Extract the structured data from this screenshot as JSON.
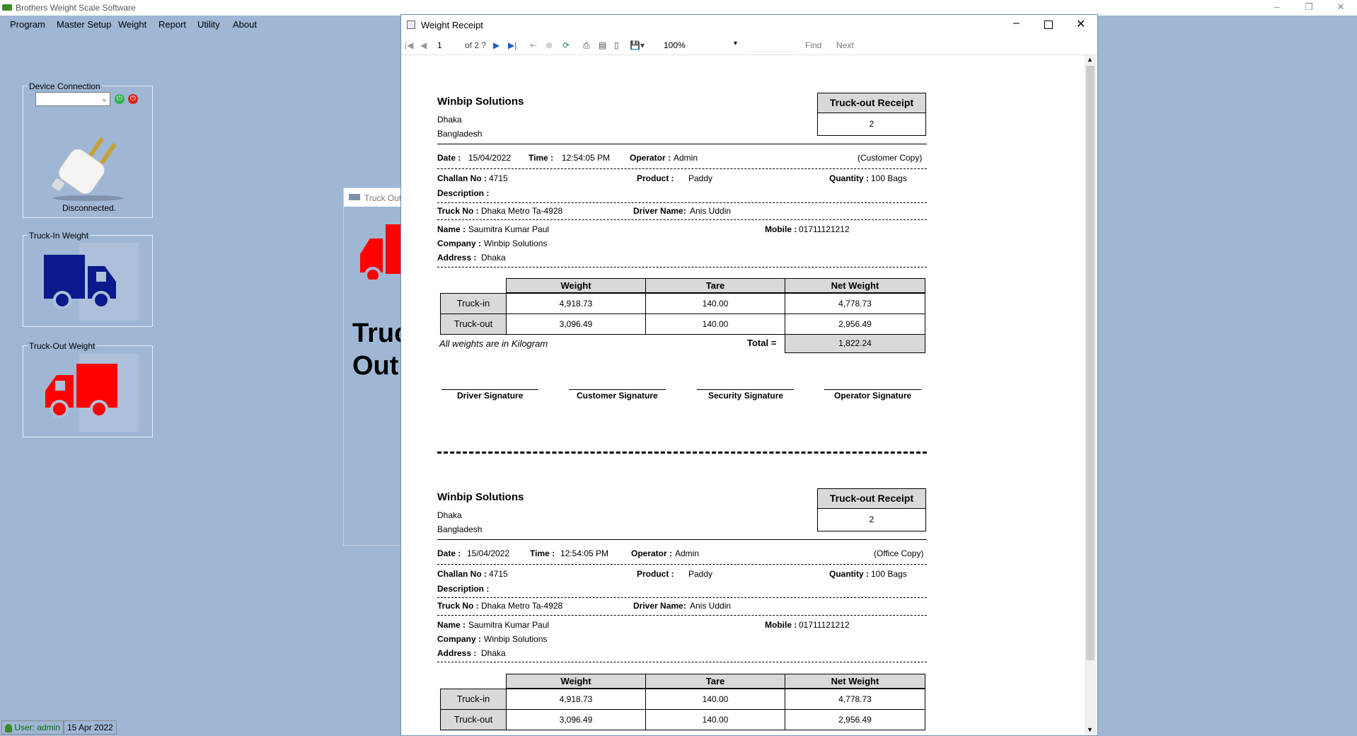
{
  "app": {
    "title": "Brothers Weight Scale Software",
    "menu": [
      "Program",
      "Master Setup",
      "Weight",
      "Report",
      "Utility",
      "About"
    ],
    "window_controls": [
      "–",
      "❐",
      "✕"
    ]
  },
  "device": {
    "group_label": "Device Connection",
    "status": "Disconnected."
  },
  "tiles": {
    "truck_in_label": "Truck-In Weight",
    "truck_out_label": "Truck-Out Weight"
  },
  "bg_form": {
    "title": "Truck Out",
    "big_text_1": "Truc",
    "big_text_2": "Out"
  },
  "status_bar": {
    "user": "User: admin",
    "date": "15 Apr 2022"
  },
  "report_window": {
    "title": "Weight Receipt",
    "page_current": "1",
    "page_of": "of  2 ?",
    "zoom": "100%",
    "find": "Find",
    "next": "Next"
  },
  "receipts": [
    {
      "company": "Winbip Solutions",
      "city": "Dhaka",
      "country": "Bangladesh",
      "receipt_title": "Truck-out Receipt",
      "receipt_no": "2",
      "date_label": "Date :",
      "date": "15/04/2022",
      "time_label": "Time :",
      "time": "12:54:05 PM",
      "operator_label": "Operator :",
      "operator": "Admin",
      "copy": "(Customer Copy)",
      "challan_label": "Challan No :",
      "challan": "4715",
      "product_label": "Product :",
      "product": "Paddy",
      "quantity_label": "Quantity :",
      "quantity": "100 Bags",
      "description_label": "Description :",
      "truck_label": "Truck No :",
      "truck": "Dhaka Metro Ta-4928",
      "driver_label": "Driver Name:",
      "driver": "Anis Uddin",
      "name_label": "Name :",
      "name": "Saumitra Kumar Paul",
      "mobile_label": "Mobile :",
      "mobile": "01711121212",
      "company_label": "Company :",
      "customer_company": "Winbip Solutions",
      "address_label": "Address :",
      "address": "Dhaka",
      "table_headers": [
        "Weight",
        "Tare",
        "Net Weight"
      ],
      "rows": [
        {
          "label": "Truck-in",
          "weight": "4,918.73",
          "tare": "140.00",
          "net": "4,778.73"
        },
        {
          "label": "Truck-out",
          "weight": "3,096.49",
          "tare": "140.00",
          "net": "2,956.49"
        }
      ],
      "unit_note": "All weights are in Kilogram",
      "total_label": "Total =",
      "total": "1,822.24",
      "signatures": [
        "Driver Signature",
        "Customer Signature",
        "Security Signature",
        "Operator Signature"
      ]
    },
    {
      "company": "Winbip Solutions",
      "city": "Dhaka",
      "country": "Bangladesh",
      "receipt_title": "Truck-out Receipt",
      "receipt_no": "2",
      "date_label": "Date :",
      "date": "15/04/2022",
      "time_label": "Time :",
      "time": "12:54:05 PM",
      "operator_label": "Operator :",
      "operator": "Admin",
      "copy": "(Office Copy)",
      "challan_label": "Challan No :",
      "challan": "4715",
      "product_label": "Product :",
      "product": "Paddy",
      "quantity_label": "Quantity :",
      "quantity": "100 Bags",
      "description_label": "Description :",
      "truck_label": "Truck No :",
      "truck": "Dhaka Metro Ta-4928",
      "driver_label": "Driver Name:",
      "driver": "Anis Uddin",
      "name_label": "Name :",
      "name": "Saumitra Kumar Paul",
      "mobile_label": "Mobile :",
      "mobile": "01711121212",
      "company_label": "Company :",
      "customer_company": "Winbip Solutions",
      "address_label": "Address :",
      "address": "Dhaka",
      "table_headers": [
        "Weight",
        "Tare",
        "Net Weight"
      ],
      "rows": [
        {
          "label": "Truck-in",
          "weight": "4,918.73",
          "tare": "140.00",
          "net": "4,778.73"
        },
        {
          "label": "Truck-out",
          "weight": "3,096.49",
          "tare": "140.00",
          "net": "2,956.49"
        }
      ]
    }
  ],
  "colors": {
    "desktop_bg": "#9fb7d5",
    "truck_in": "#0a1a8c",
    "truck_out": "#ff0000",
    "table_header": "#d9d9d9"
  }
}
